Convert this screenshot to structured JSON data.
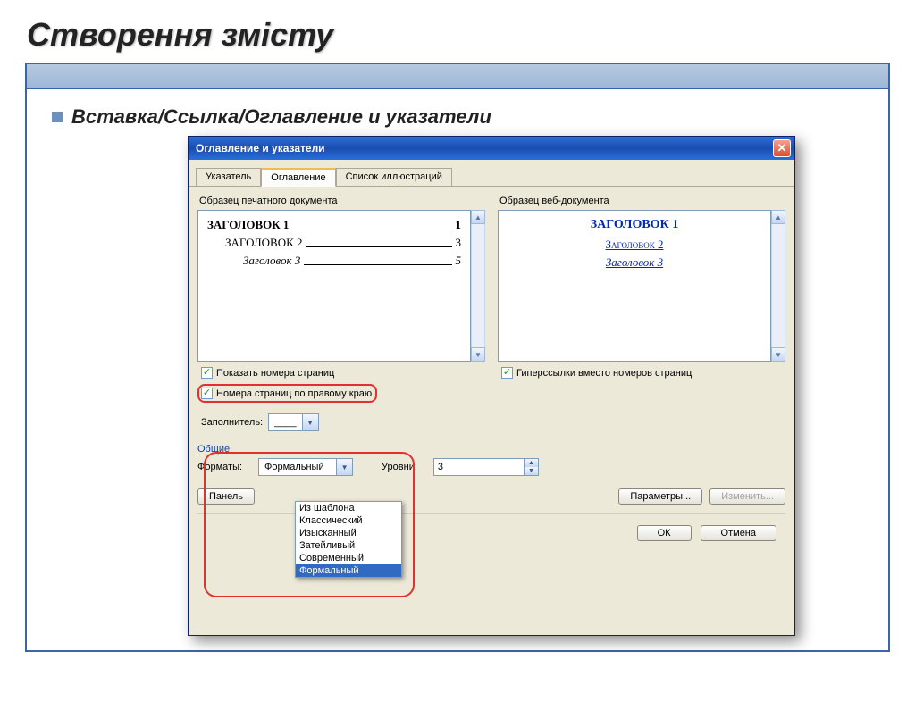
{
  "slide": {
    "title": "Створення змісту",
    "subtitle": "Вставка/Ссылка/Оглавление и указатели"
  },
  "dialog": {
    "title": "Оглавление и указатели",
    "tabs": [
      "Указатель",
      "Оглавление",
      "Список иллюстраций"
    ],
    "print_label": "Образец печатного документа",
    "web_label": "Образец веб-документа",
    "toc_print": [
      {
        "title": "ЗАГОЛОВОК 1",
        "page": "1"
      },
      {
        "title": "ЗАГОЛОВОК 2",
        "page": "3"
      },
      {
        "title": "Заголовок 3",
        "page": "5"
      }
    ],
    "toc_web": [
      "ЗАГОЛОВОК 1",
      "Заголовок 2",
      "Заголовок 3"
    ],
    "chk_show_pages": "Показать номера страниц",
    "chk_right_align": "Номера страниц по правому краю",
    "chk_hyperlinks": "Гиперссылки вместо номеров страниц",
    "fill_label": "Заполнитель:",
    "fill_value": "____",
    "group_general": "Общие",
    "formats_label": "Форматы:",
    "formats_value": "Формальный",
    "levels_label": "Уровни:",
    "levels_value": "3",
    "panel_btn": "Панель",
    "params_btn": "Параметры...",
    "modify_btn": "Изменить...",
    "ok": "ОК",
    "cancel": "Отмена",
    "format_options": [
      "Из шаблона",
      "Классический",
      "Изысканный",
      "Затейливый",
      "Современный",
      "Формальный"
    ]
  }
}
